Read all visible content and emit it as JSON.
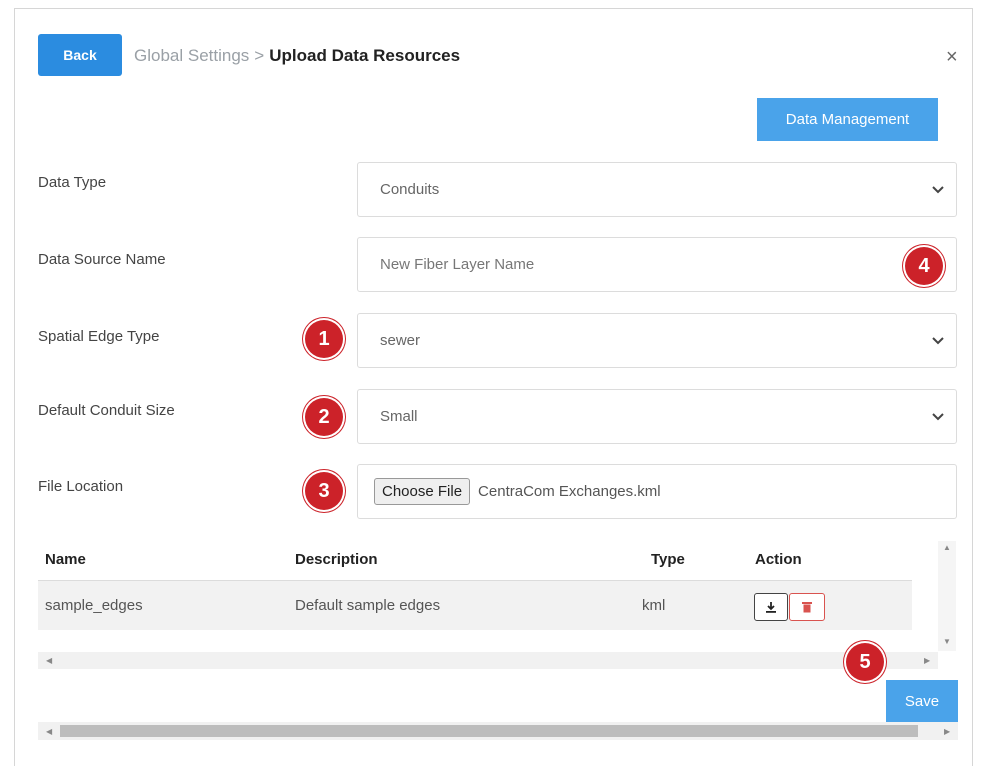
{
  "header": {
    "back_label": "Back",
    "breadcrumb_parent": "Global Settings",
    "breadcrumb_separator": ">",
    "breadcrumb_current": "Upload Data Resources",
    "close_symbol": "×"
  },
  "data_management_label": "Data Management",
  "form": {
    "data_type": {
      "label": "Data Type",
      "value": "Conduits"
    },
    "data_source_name": {
      "label": "Data Source Name",
      "placeholder": "New Fiber Layer Name"
    },
    "spatial_edge_type": {
      "label": "Spatial Edge Type",
      "value": "sewer"
    },
    "default_conduit_size": {
      "label": "Default Conduit Size",
      "value": "Small"
    },
    "file_location": {
      "label": "File Location",
      "button_label": "Choose File",
      "file_name": "CentraCom Exchanges.kml"
    }
  },
  "badges": {
    "b1": "1",
    "b2": "2",
    "b3": "3",
    "b4": "4",
    "b5": "5"
  },
  "table": {
    "headers": {
      "name": "Name",
      "description": "Description",
      "type": "Type",
      "action": "Action"
    },
    "rows": [
      {
        "name": "sample_edges",
        "description": "Default sample edges",
        "type": "kml"
      }
    ]
  },
  "save_label": "Save",
  "colors": {
    "primary": "#2b8ce0",
    "light_primary": "#4aa3ea",
    "badge": "#cc2229",
    "danger": "#d9534f"
  },
  "icons": {
    "close": "close-icon",
    "chevron": "chevron-down-icon",
    "download": "download-icon",
    "delete": "trash-icon"
  }
}
